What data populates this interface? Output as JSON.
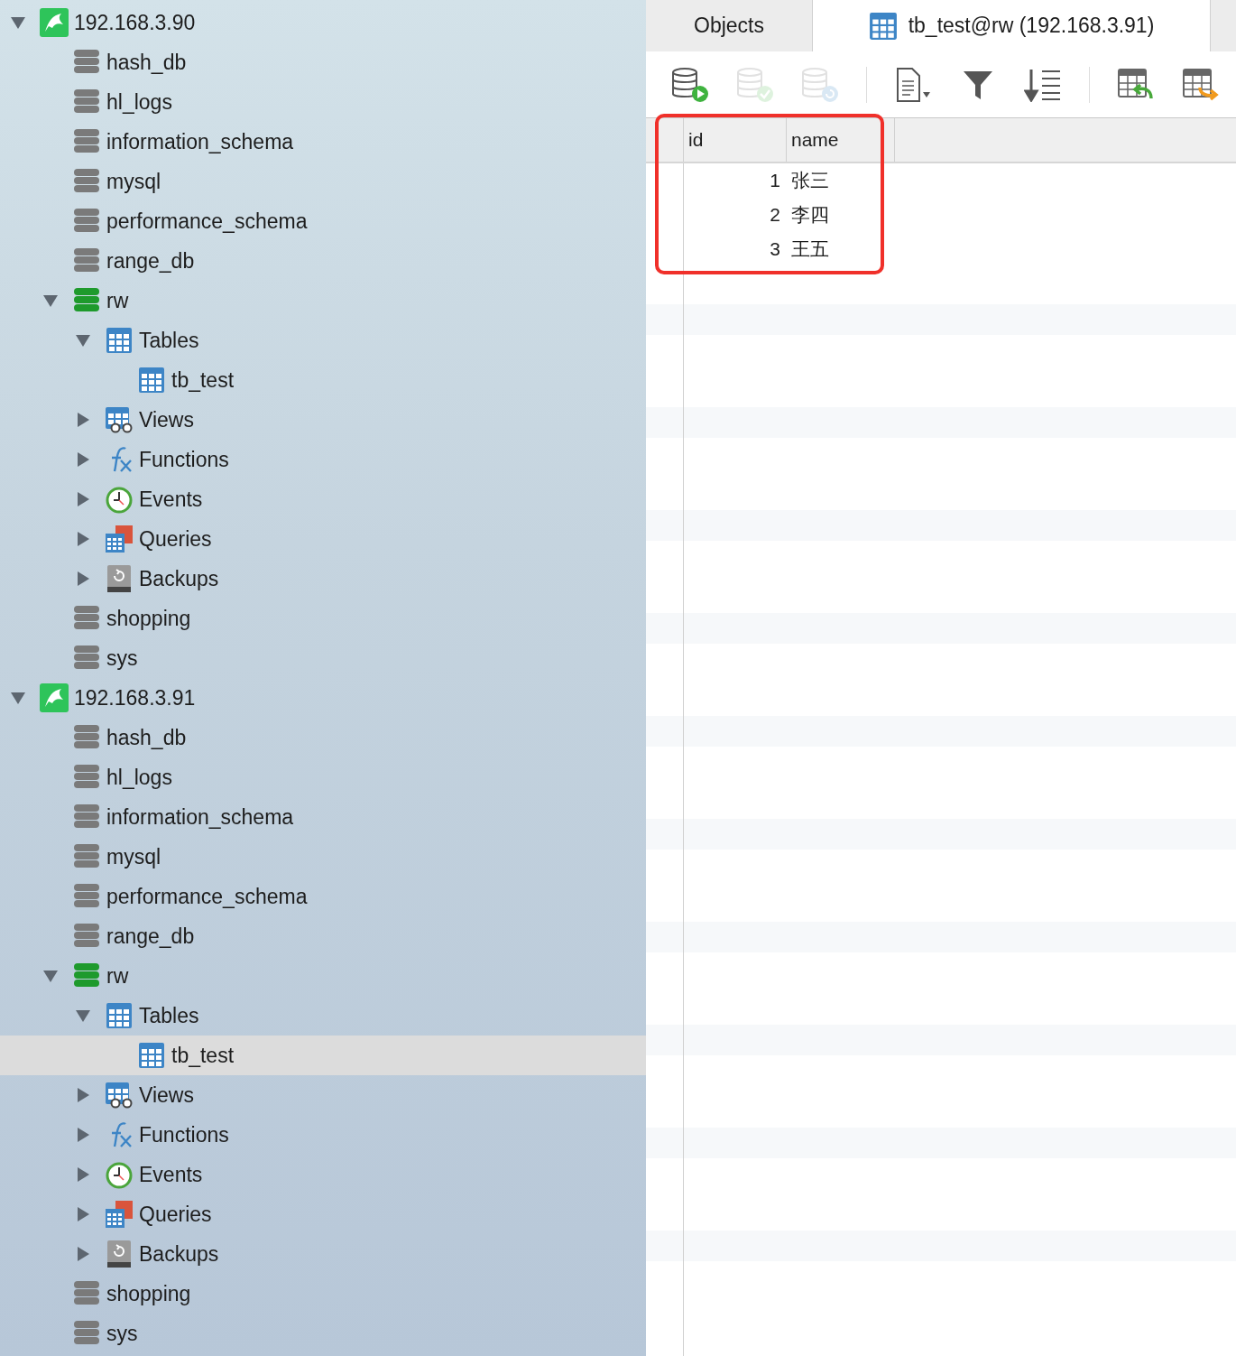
{
  "tree": [
    {
      "kind": "connection",
      "label": "192.168.3.90",
      "expanded": true,
      "selected": false,
      "children": [
        {
          "kind": "database",
          "label": "hash_db",
          "open": false,
          "selected": false
        },
        {
          "kind": "database",
          "label": "hl_logs",
          "open": false,
          "selected": false
        },
        {
          "kind": "database",
          "label": "information_schema",
          "open": false,
          "selected": false
        },
        {
          "kind": "database",
          "label": "mysql",
          "open": false,
          "selected": false
        },
        {
          "kind": "database",
          "label": "performance_schema",
          "open": false,
          "selected": false
        },
        {
          "kind": "database",
          "label": "range_db",
          "open": false,
          "selected": false
        },
        {
          "kind": "database",
          "label": "rw",
          "open": true,
          "expanded": true,
          "selected": false,
          "children": [
            {
              "kind": "tables",
              "label": "Tables",
              "expanded": true,
              "selected": false,
              "children": [
                {
                  "kind": "table",
                  "label": "tb_test",
                  "selected": false
                }
              ]
            },
            {
              "kind": "views",
              "label": "Views",
              "expanded": false,
              "selected": false
            },
            {
              "kind": "functions",
              "label": "Functions",
              "expanded": false,
              "selected": false
            },
            {
              "kind": "events",
              "label": "Events",
              "expanded": false,
              "selected": false
            },
            {
              "kind": "queries",
              "label": "Queries",
              "expanded": false,
              "selected": false
            },
            {
              "kind": "backups",
              "label": "Backups",
              "expanded": false,
              "selected": false
            }
          ]
        },
        {
          "kind": "database",
          "label": "shopping",
          "open": false,
          "selected": false
        },
        {
          "kind": "database",
          "label": "sys",
          "open": false,
          "selected": false
        }
      ]
    },
    {
      "kind": "connection",
      "label": "192.168.3.91",
      "expanded": true,
      "selected": false,
      "children": [
        {
          "kind": "database",
          "label": "hash_db",
          "open": false,
          "selected": false
        },
        {
          "kind": "database",
          "label": "hl_logs",
          "open": false,
          "selected": false
        },
        {
          "kind": "database",
          "label": "information_schema",
          "open": false,
          "selected": false
        },
        {
          "kind": "database",
          "label": "mysql",
          "open": false,
          "selected": false
        },
        {
          "kind": "database",
          "label": "performance_schema",
          "open": false,
          "selected": false
        },
        {
          "kind": "database",
          "label": "range_db",
          "open": false,
          "selected": false
        },
        {
          "kind": "database",
          "label": "rw",
          "open": true,
          "expanded": true,
          "selected": false,
          "children": [
            {
              "kind": "tables",
              "label": "Tables",
              "expanded": true,
              "selected": false,
              "children": [
                {
                  "kind": "table",
                  "label": "tb_test",
                  "selected": true
                }
              ]
            },
            {
              "kind": "views",
              "label": "Views",
              "expanded": false,
              "selected": false
            },
            {
              "kind": "functions",
              "label": "Functions",
              "expanded": false,
              "selected": false
            },
            {
              "kind": "events",
              "label": "Events",
              "expanded": false,
              "selected": false
            },
            {
              "kind": "queries",
              "label": "Queries",
              "expanded": false,
              "selected": false
            },
            {
              "kind": "backups",
              "label": "Backups",
              "expanded": false,
              "selected": false
            }
          ]
        },
        {
          "kind": "database",
          "label": "shopping",
          "open": false,
          "selected": false
        },
        {
          "kind": "database",
          "label": "sys",
          "open": false,
          "selected": false
        }
      ]
    }
  ],
  "tabs": [
    {
      "label": "Objects",
      "selected": false,
      "kind": "objects"
    },
    {
      "label": "tb_test@rw (192.168.3.91)",
      "selected": true,
      "kind": "table"
    }
  ],
  "toolbar": [
    {
      "kind": "db-run",
      "disabled": false
    },
    {
      "kind": "db-check",
      "disabled": true
    },
    {
      "kind": "db-revert",
      "disabled": true
    },
    {
      "kind": "separator"
    },
    {
      "kind": "text",
      "disabled": false
    },
    {
      "kind": "filter",
      "disabled": false
    },
    {
      "kind": "sort",
      "disabled": false
    },
    {
      "kind": "separator"
    },
    {
      "kind": "import",
      "disabled": false
    },
    {
      "kind": "export",
      "disabled": false
    }
  ],
  "table": {
    "columns": [
      "id",
      "name"
    ],
    "rows": [
      [
        "1",
        "张三"
      ],
      [
        "2",
        "李四"
      ],
      [
        "3",
        "王五"
      ]
    ]
  }
}
